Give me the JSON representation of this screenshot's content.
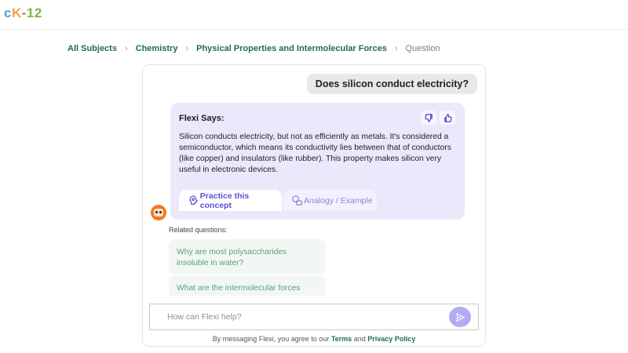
{
  "brand": {
    "logo_text": "cK-12"
  },
  "breadcrumb": {
    "items": [
      "All Subjects",
      "Chemistry",
      "Physical Properties and Intermolecular Forces",
      "Question"
    ]
  },
  "chat": {
    "user_question": "Does silicon conduct electricity?",
    "flexi_label": "Flexi Says:",
    "flexi_answer": "Silicon conducts electricity, but not as efficiently as metals. It's considered a semiconductor, which means its conductivity lies between that of conductors (like copper) and insulators (like rubber). This property makes silicon very useful in electronic devices.",
    "actions": {
      "practice": "Practice this concept",
      "analogy": "Analogy / Example"
    },
    "icons": {
      "thumbs_down": "thumbs-down-icon",
      "thumbs_up": "thumbs-up-icon",
      "practice": "brain-icon",
      "analogy": "shapes-icon",
      "send": "send-icon",
      "avatar": "flexi-avatar"
    }
  },
  "related": {
    "label": "Related questions:",
    "items": [
      "Why are most polysaccharides insoluble in water?",
      "What are the intermolecular forces"
    ]
  },
  "input": {
    "placeholder": "How can Flexi help?"
  },
  "footer": {
    "prefix": "By messaging Flexi, you agree to our",
    "terms": "Terms",
    "and": "and",
    "privacy": "Privacy Policy"
  },
  "colors": {
    "accent": "#5b4fd2",
    "brand_green": "#1f6f45",
    "flexi_card_bg": "#ebe8fb",
    "related_text": "#53a27a"
  }
}
